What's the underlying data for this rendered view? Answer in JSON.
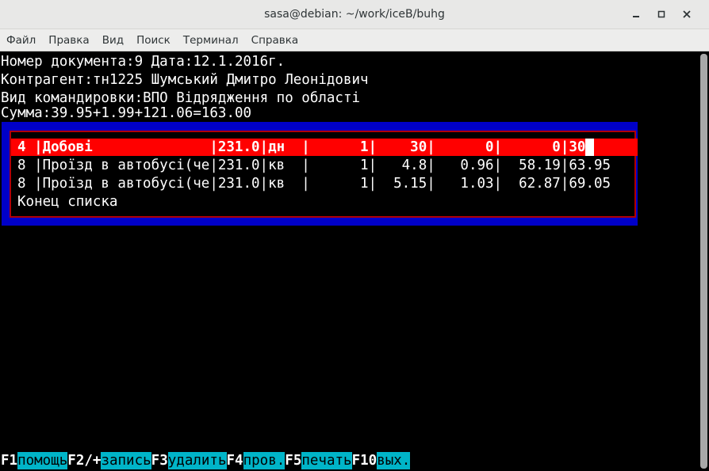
{
  "window": {
    "title": "sasa@debian: ~/work/iceB/buhg"
  },
  "menu": {
    "items": [
      "Файл",
      "Правка",
      "Вид",
      "Поиск",
      "Терминал",
      "Справка"
    ]
  },
  "header": {
    "line1": "Номер документа:9 Дата:12.1.2016г.",
    "line2": "Контрагент:тн1225 Шумський Дмитро Леонідович",
    "line3": "Вид командировки:ВПО Відрядження по області",
    "line4": "Сумма:39.95+1.99+121.06=163.00"
  },
  "list": {
    "rows": [
      "4 |Добові              |231.0|дн  |      1|    30|      0|      0|30",
      "8 |Проїзд в автобусі(че|231.0|кв  |      1|   4.8|   0.96|  58.19|63.95",
      "8 |Проїзд в автобусі(че|231.0|кв  |      1|  5.15|   1.03|  62.87|69.05",
      "Конец списка"
    ],
    "selected_index": 0
  },
  "fkeys": [
    {
      "key": "F1",
      "label": "помощь"
    },
    {
      "key": "F2/+",
      "label": "запись"
    },
    {
      "key": "F3",
      "label": "удалить"
    },
    {
      "key": "F4",
      "label": "пров."
    },
    {
      "key": "F5",
      "label": "печать"
    },
    {
      "key": "F10",
      "label": "вых."
    }
  ],
  "colors": {
    "dialog_bg": "#0000c8",
    "selected_bg": "#ff0000",
    "fkey_label_bg": "#00b4c8"
  }
}
